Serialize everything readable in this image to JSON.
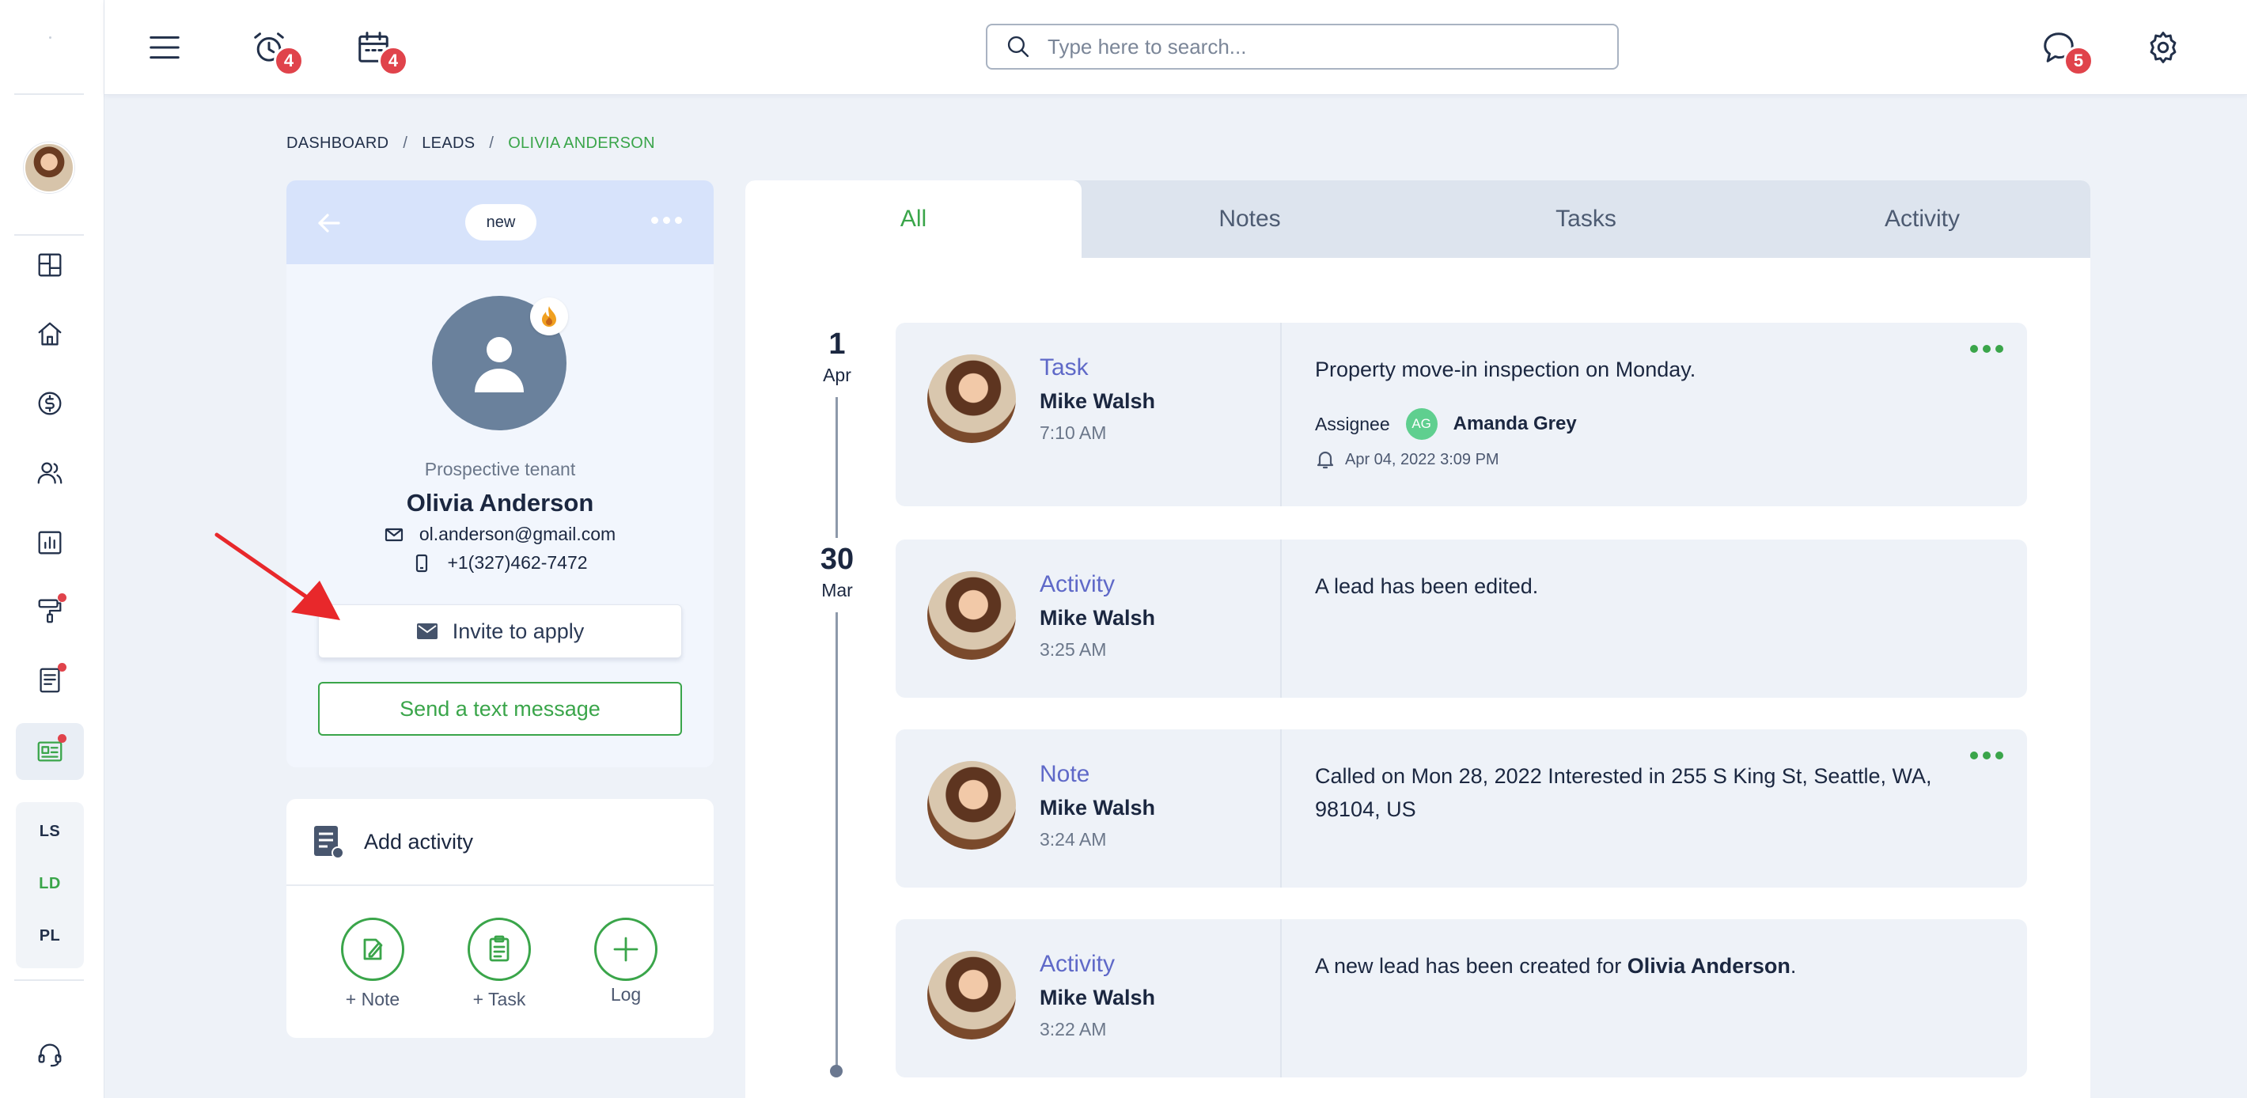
{
  "rail": {
    "sub_items": [
      "LS",
      "LD",
      "PL"
    ]
  },
  "topbar": {
    "alarm_badge": "4",
    "calendar_badge": "4",
    "chat_badge": "5",
    "search_placeholder": "Type here to search..."
  },
  "breadcrumb": {
    "items": [
      "DASHBOARD",
      "LEADS",
      "OLIVIA ANDERSON"
    ]
  },
  "lead": {
    "status": "new",
    "role": "Prospective tenant",
    "name": "Olivia Anderson",
    "email": "ol.anderson@gmail.com",
    "phone": "+1(327)462-7472",
    "invite_label": "Invite to apply",
    "sms_label": "Send a text message"
  },
  "add_activity": {
    "title": "Add activity",
    "buttons": [
      "+ Note",
      "+ Task",
      "Log"
    ]
  },
  "tabs": [
    "All",
    "Notes",
    "Tasks",
    "Activity"
  ],
  "timeline": {
    "dates": [
      {
        "day": "1",
        "month": "Apr"
      },
      {
        "day": "30",
        "month": "Mar"
      }
    ],
    "entries": [
      {
        "type": "Task",
        "author": "Mike Walsh",
        "time": "7:10 AM",
        "message": "Property move-in inspection on Monday.",
        "assignee_label": "Assignee",
        "assignee_initials": "AG",
        "assignee_name": "Amanda Grey",
        "reminder": "Apr 04, 2022 3:09 PM"
      },
      {
        "type": "Activity",
        "author": "Mike Walsh",
        "time": "3:25 AM",
        "message": "A lead has been edited."
      },
      {
        "type": "Note",
        "author": "Mike Walsh",
        "time": "3:24 AM",
        "message": "Called on Mon 28, 2022 Interested in 255 S King St, Seattle, WA, 98104, US"
      },
      {
        "type": "Activity",
        "author": "Mike Walsh",
        "time": "3:22 AM",
        "message_prefix": "A new lead has been created for ",
        "message_bold": "Olivia Anderson",
        "message_suffix": "."
      }
    ]
  },
  "colors": {
    "accent_green": "#3aa54a",
    "badge_red": "#e0434b",
    "entry_type_purple": "#5f69c8",
    "header_blue": "#d7e3fb"
  }
}
